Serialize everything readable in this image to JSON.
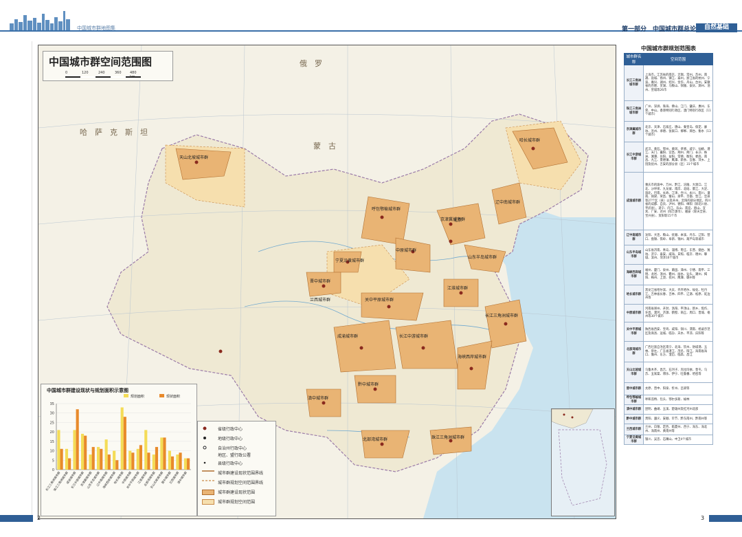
{
  "header": {
    "book_title": "中国城市群地图集",
    "section": "第一部分　中国城市群总论",
    "tag": "自然基础"
  },
  "map": {
    "title": "中国城市群空间范围图",
    "scale_labels": [
      "0",
      "120",
      "240",
      "360",
      "480 km"
    ],
    "place_labels": {
      "mongolia": "蒙　古",
      "russia": "俄　罗",
      "kazakhstan": "哈　萨　克　斯　坦",
      "beijing": "北京"
    },
    "cluster_labels": [
      "天山北坡城市群",
      "哈长城市群",
      "辽中南城市群",
      "京津冀城市群",
      "呼包鄂榆城市群",
      "山东半岛城市群",
      "宁夏沿黄城市群",
      "晋中城市群",
      "兰西城市群",
      "中原城市群",
      "关中平原城市群",
      "江淮城市群",
      "长江三角洲城市群",
      "成渝城市群",
      "长江中游城市群",
      "海峡西岸城市群",
      "黔中城市群",
      "滇中城市群",
      "北部湾城市群",
      "珠江三角洲城市群"
    ],
    "legend": [
      {
        "label": "省级行政中心",
        "symbol": "dot-capital"
      },
      {
        "label": "地级行政中心",
        "symbol": "dot-prefecture"
      },
      {
        "label": "自治州行政中心",
        "symbol": "dot-plain"
      },
      {
        "label": "地区、盟行政公署",
        "symbol": "none"
      },
      {
        "label": "县级行政中心",
        "symbol": "dot-small"
      },
      {
        "label": "城市群建设现状范围界线",
        "symbol": "line-solid"
      },
      {
        "label": "城市群规划空间范围界线",
        "symbol": "line-dashed"
      },
      {
        "label": "城市群建设现状范围",
        "symbol": "fill-current"
      },
      {
        "label": "城市群规划空间范围",
        "symbol": "fill-planned"
      }
    ],
    "colors": {
      "water": "#c9e3ef",
      "land": "#f4f1e6",
      "cluster_current": "#e9b474",
      "cluster_planned": "#f6dfae",
      "bar_planned": "#f4dc57",
      "bar_current": "#e88a2b"
    }
  },
  "chart_data": {
    "type": "bar",
    "title": "中国城市群建设现状与规划面积示意图",
    "series": [
      {
        "name": "规划面积",
        "values": [
          21,
          11,
          21,
          19,
          8,
          12,
          16,
          10,
          33,
          10,
          11,
          21,
          8,
          17,
          10,
          8,
          6
        ]
      },
      {
        "name": "现状面积",
        "values": [
          11,
          6,
          32,
          18,
          12,
          11,
          8,
          5,
          28,
          9,
          13,
          9,
          12,
          17,
          7,
          9,
          6
        ]
      }
    ],
    "categories": [
      "长江三角洲城市群",
      "珠江三角洲城市群",
      "成渝城市群",
      "长江中游城市群",
      "京津冀城市群",
      "山东半岛城市群",
      "辽中南城市群",
      "海峡西岸城市群",
      "哈长城市群",
      "中原城市群",
      "关中平原城市群",
      "江淮城市群",
      "北部湾城市群",
      "天山北坡城市群",
      "晋中城市群",
      "兰西城市群",
      "滇中城市群"
    ],
    "ylim": [
      0,
      35
    ],
    "yticks": [
      "0",
      "5",
      "10",
      "15",
      "20",
      "25",
      "30",
      "35"
    ]
  },
  "table": {
    "title": "中国城市群规划范围表",
    "headers": [
      "城市群名称",
      "空间范围"
    ],
    "rows": [
      {
        "name": "长江三角洲城市群",
        "text": "上海市，江苏省的南京、无锡、常州、苏州、南通、盐城、扬州、镇江、泰州，浙江省的杭州、宁波、嘉兴、湖州、绍兴、金华、舟山、台州，安徽省的合肥、芜湖、马鞍山、铜陵、安庆、滁州、池州、宣城等26市"
      },
      {
        "name": "珠江三角洲城市群",
        "text": "广州、深圳、珠海、佛山、江门、肇庆、惠州、东莞、中山，香港特别行政区、澳门特别行政区（11个城市）"
      },
      {
        "name": "京津冀城市群",
        "text": "北京、天津、石家庄、唐山、秦皇岛、保定、廊坊、沧州、承德、张家口、邯郸、邢台、衡水（13个城市）"
      },
      {
        "name": "长江中游城市群",
        "text": "武汉、黄石、鄂州、黄冈、孝感、咸宁、仙桃、潜江、天门、襄阳、宜昌、荆州、荆门、长沙、株洲、湘潭、岳阳、益阳、常德、衡阳、娄底、南昌、九江、景德镇、鹰潭、新余、宜春、萍乡、上饶及抚州、吉安的部分县（区）31个城市"
      },
      {
        "name": "成渝城市群",
        "text": "重庆市的渝中、万州、黔江、涪陵、大渡口、江北、沙坪坝、九龙坡、南岸、北碚、綦江、大足、渝北、巴南、长寿、江津、合川、永川、南川、潼南、铜梁、荣昌、璧山、梁平、丰都、垫江、忠县等27个区（县）以及开州、云阳的部分地区，四川省的成都、自贡、泸州、德阳、绵阳（除北川县、平武县）、遂宁、内江、乐山、南充、眉山、宜宾、广安、达州（除万源市）、雅安（除天全县、宝兴县）、资阳等15个市"
      },
      {
        "name": "辽中南城市群",
        "text": "沈阳、大连、鞍山、抚顺、本溪、丹东、辽阳、营口、盘锦、铁岭、阜新、锦州、葫芦岛等城市"
      },
      {
        "name": "山东半岛城市群",
        "text": "山东省济南、青岛、淄博、枣庄、东营、烟台、潍坊、济宁、泰安、威海、日照、临沂、德州、聊城、滨州、菏泽16个城市"
      },
      {
        "name": "海峡西岸城市群",
        "text": "福州、厦门、泉州、莆田、漳州、宁德、南平、三明、龙岩、温州、衢州、丽水、汕头、潮州、揭阳、梅州、上饶、抚州、鹰潭、赣州等"
      },
      {
        "name": "哈长城市群",
        "text": "黑龙江省哈尔滨、大庆、齐齐哈尔、绥化、牡丹江、吉林省长春、吉林、四平、辽源、松原、延边州等"
      },
      {
        "name": "中原城市群",
        "text": "河南省郑州、开封、洛阳、平顶山、新乡、焦作、许昌、漯河、济源、鹤壁、商丘、周口、晋城、亳州等30个城市"
      },
      {
        "name": "关中平原城市群",
        "text": "陕西省西安、宝鸡、咸阳、铜川、渭南、杨凌示范区及商洛、运城、临汾、天水、平凉、庆阳等"
      },
      {
        "name": "北部湾城市群",
        "text": "广西壮族自治区南宁、北海、钦州、防城港、玉林、崇左，广东省湛江、茂名、阳江，海南省海口、儋州、东方、澄迈、临高、昌江"
      },
      {
        "name": "天山北坡城市群",
        "text": "乌鲁木齐、昌吉、石河子、克拉玛依、奎屯、乌苏、五家渠、博乐、伊宁、吐鲁番、哈密等"
      },
      {
        "name": "晋中城市群",
        "text": "太原、晋中、阳泉、忻州、吕梁等"
      },
      {
        "name": "呼包鄂榆城市群",
        "text": "呼和浩特、包头、鄂尔多斯、榆林"
      },
      {
        "name": "滇中城市群",
        "text": "昆明、曲靖、玉溪、楚雄州及红河州北部"
      },
      {
        "name": "黔中城市群",
        "text": "贵阳、遵义、安顺、毕节、黔东南州、黔南州等"
      },
      {
        "name": "兰西城市群",
        "text": "兰州、白银、定西、临夏州、西宁、海东、海北州、海南州、黄南州等"
      },
      {
        "name": "宁夏沿黄城市群",
        "text": "银川、吴忠、石嘴山、中卫4个城市"
      }
    ]
  },
  "footer": {
    "left_page": "2",
    "right_page": "3"
  }
}
